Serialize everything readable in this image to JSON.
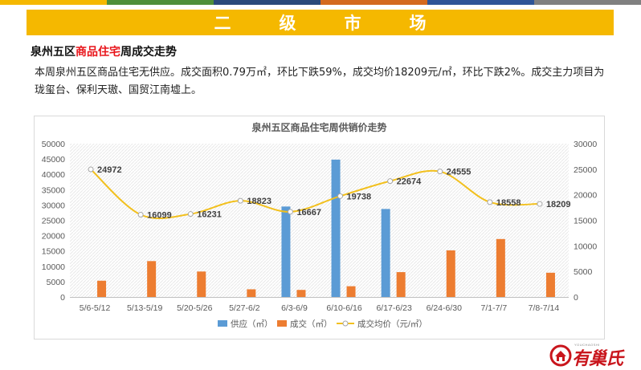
{
  "colors": {
    "stripes": [
      "#f5b800",
      "#4e8f3a",
      "#2b4a7a",
      "#d4691e",
      "#2f5597",
      "#808080"
    ],
    "banner": "#f5b800",
    "supply": "#5b9bd5",
    "deal": "#ed7d31",
    "price": "#f2c01e",
    "highlight": "#e8151b",
    "brand": "#c9161d"
  },
  "banner": {
    "title": "二级市场"
  },
  "section": {
    "title_pre": "泉州五区",
    "title_hl": "商品住宅",
    "title_post": "周成交走势",
    "paragraph": "本周泉州五区商品住宅无供应。成交面积0.79万㎡，环比下跌59%，成交均价18209元/㎡，环比下跌2%。成交主力项目为珑玺台、保利天璈、国贸江南墟上。"
  },
  "logo": {
    "text": "有巢氏",
    "sub": "YOUCHAOSHI"
  },
  "chart_data": {
    "type": "bar",
    "title": "泉州五区商品住宅周供销价走势",
    "categories": [
      "5/6-5/12",
      "5/13-5/19",
      "5/20-5/26",
      "5/27-6/2",
      "6/3-6/9",
      "6/10-6/16",
      "6/17-6/23",
      "6/24-6/30",
      "7/1-7/7",
      "7/8-7/14"
    ],
    "series": [
      {
        "name": "供应（㎡）",
        "type": "bar",
        "axis": "left",
        "values": [
          0,
          0,
          0,
          0,
          29500,
          44800,
          28700,
          0,
          0,
          0
        ]
      },
      {
        "name": "成交（㎡）",
        "type": "bar",
        "axis": "left",
        "values": [
          5300,
          11700,
          8300,
          2500,
          2300,
          3500,
          8100,
          15200,
          18900,
          7900
        ]
      },
      {
        "name": "成交均价（元/㎡）",
        "type": "line",
        "axis": "right",
        "values": [
          24972,
          16099,
          16231,
          18823,
          16667,
          19738,
          22674,
          24555,
          18558,
          18209
        ]
      }
    ],
    "y_left": {
      "min": 0,
      "max": 50000,
      "ticks": [
        0,
        5000,
        10000,
        15000,
        20000,
        25000,
        30000,
        35000,
        40000,
        45000,
        50000
      ]
    },
    "y_right": {
      "min": 0,
      "max": 30000,
      "ticks": [
        0,
        5000,
        10000,
        15000,
        20000,
        25000,
        30000
      ]
    },
    "grid": false,
    "legend": "bottom"
  }
}
